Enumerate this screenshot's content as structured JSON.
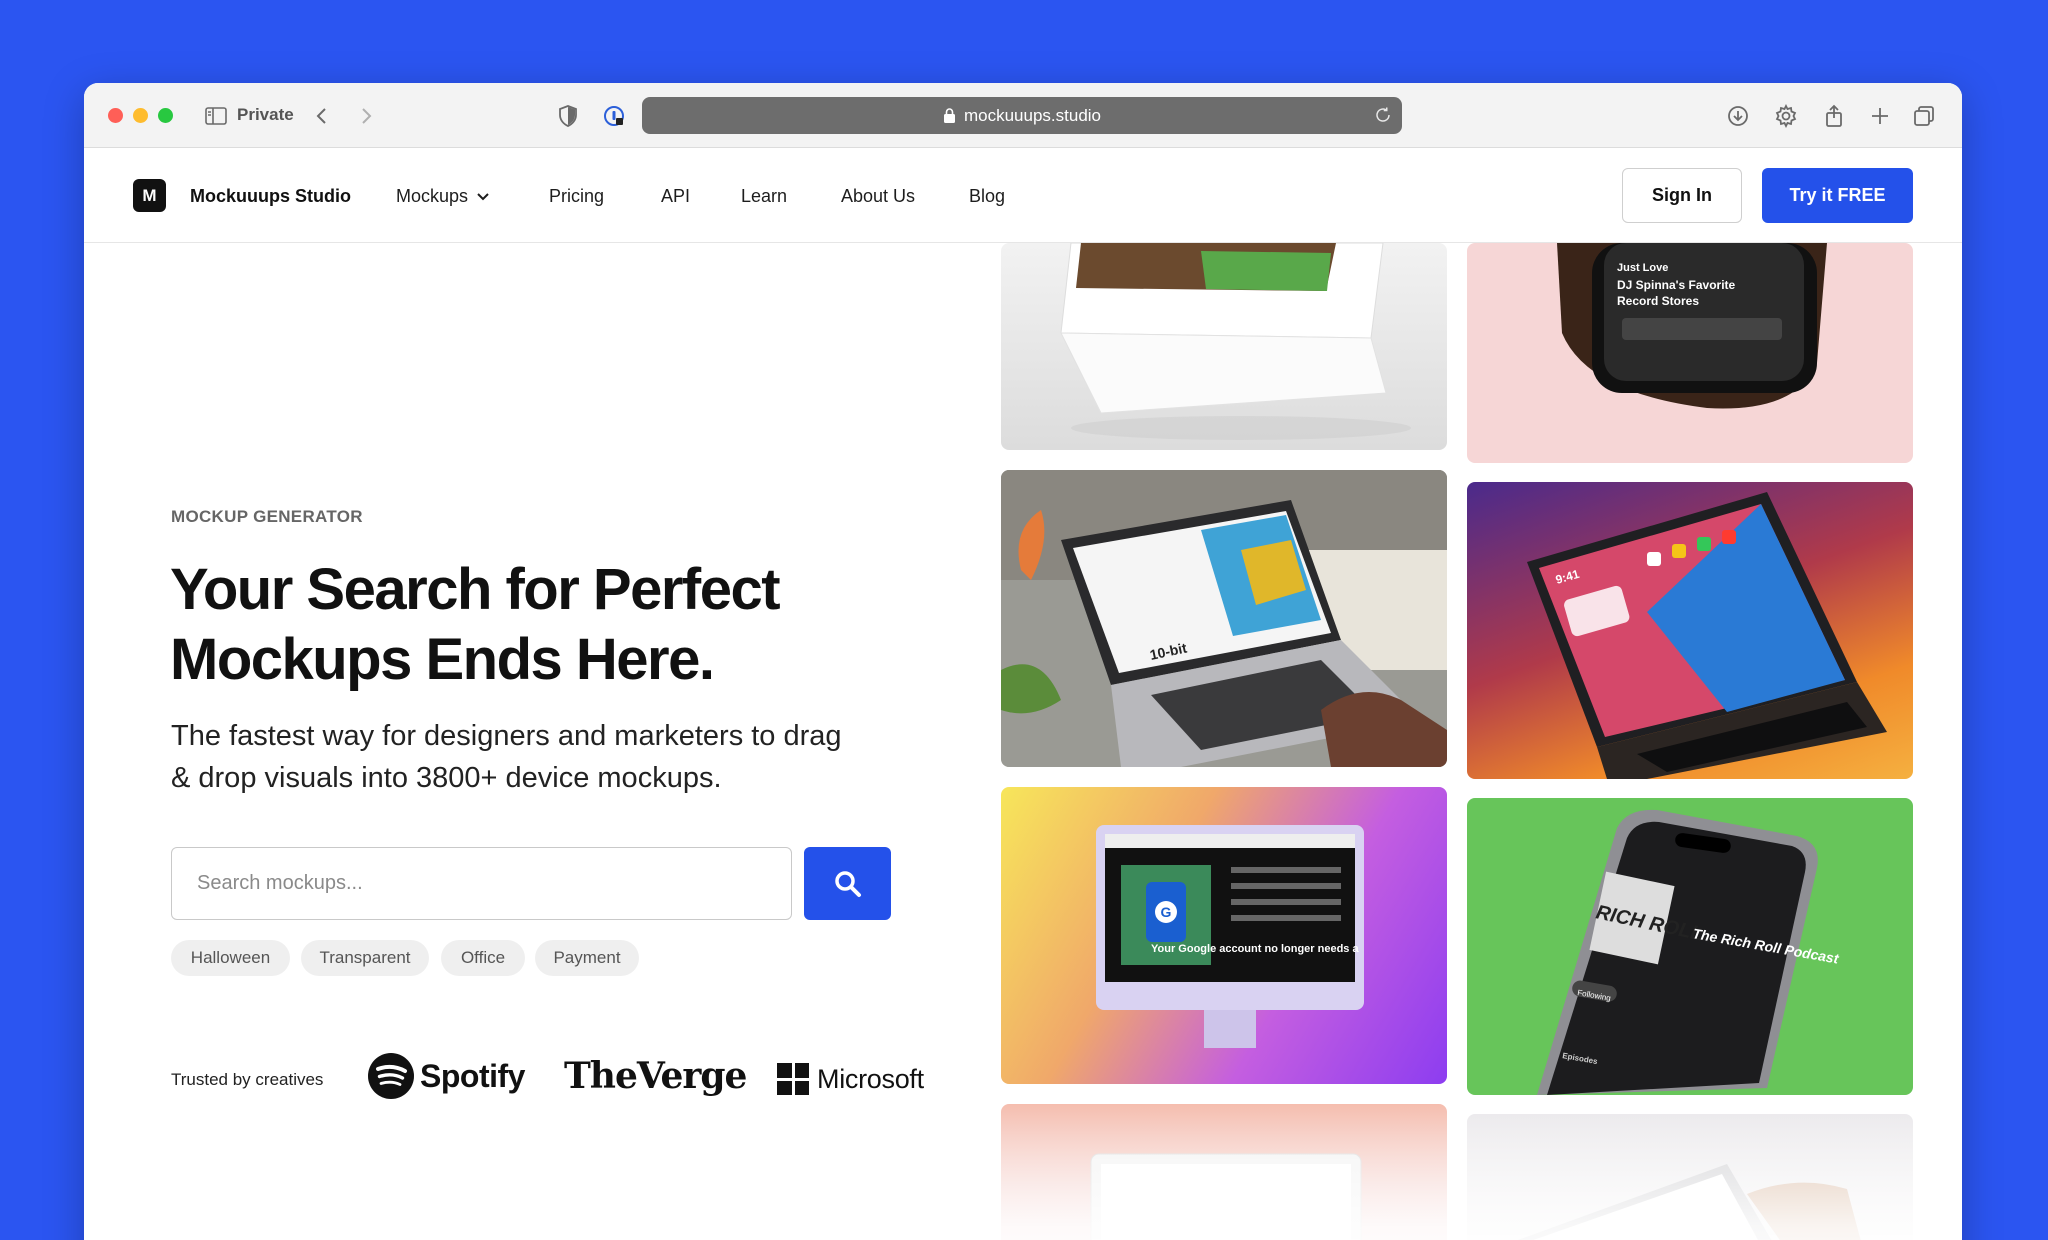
{
  "browser": {
    "private_label": "Private",
    "url": "mockuuups.studio"
  },
  "site": {
    "logo_letter": "M",
    "brand": "Mockuuups Studio",
    "nav": {
      "mockups": "Mockups",
      "pricing": "Pricing",
      "api": "API",
      "learn": "Learn",
      "about": "About Us",
      "blog": "Blog"
    },
    "sign_in": "Sign In",
    "try_free": "Try it FREE"
  },
  "hero": {
    "eyebrow": "MOCKUP GENERATOR",
    "headline_line1": "Your Search for Perfect",
    "headline_line2": "Mockups Ends Here.",
    "subhead_line1": "The fastest way for designers and marketers to drag",
    "subhead_line2": "& drop visuals into 3800+ device mockups.",
    "search_placeholder": "Search mockups...",
    "tags": [
      "Halloween",
      "Transparent",
      "Office",
      "Payment"
    ],
    "trusted_label": "Trusted by creatives",
    "trusted_logos": [
      "Spotify",
      "TheVerge",
      "Microsoft"
    ]
  },
  "gallery": {
    "phone_card_line1": "Just Love",
    "phone_card_line2": "DJ Spinna's Favorite",
    "phone_card_line3": "Record Stores",
    "laptop_screen_text": "10-bit",
    "imac_screen_text": "Your Google account no longer needs a",
    "podcast_title": "The Rich Roll Podcast",
    "podcast_art": "RICH ROLL",
    "podcast_follow": "Following",
    "podcast_tabs": "Episodes",
    "ipad_time": "9:41"
  },
  "colors": {
    "background": "#2b55f1",
    "primary_button": "#2451ea"
  }
}
